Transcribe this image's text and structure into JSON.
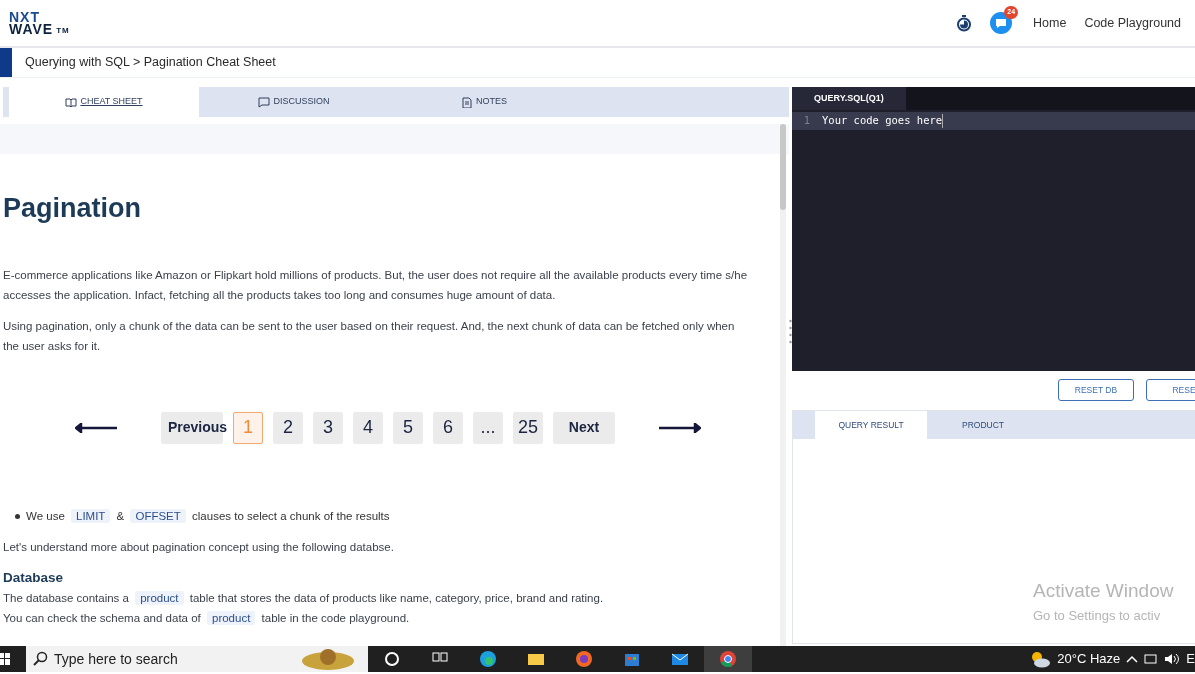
{
  "header": {
    "logo": {
      "line1": "NXT",
      "line2": "WAVE",
      "mark": "TM"
    },
    "notification_count": "24",
    "nav_links": [
      "Home",
      "Code Playground"
    ]
  },
  "breadcrumb": "Querying with SQL > Pagination Cheat Sheet",
  "left_tabs": [
    {
      "label": "CHEAT SHEET",
      "kind": "book",
      "selected": true
    },
    {
      "label": "DISCUSSION",
      "kind": "chat",
      "selected": false
    },
    {
      "label": "NOTES",
      "kind": "notes",
      "selected": false
    }
  ],
  "article": {
    "title": "Pagination",
    "paragraphs": [
      "E-commerce applications like Amazon or Flipkart hold millions of products. But, the user does not require all the available products every time s/he accesses the application. Infact, fetching all the products takes too long and consumes huge amount of data.",
      "Using pagination, only a chunk of the data can be sent to the user based on their request. And, the next chunk of data can be fetched only when the user asks for it."
    ],
    "pager": {
      "previous": "Previous",
      "next": "Next",
      "pages": [
        {
          "label": "1",
          "selected": true
        },
        {
          "label": "2",
          "selected": false
        },
        {
          "label": "3",
          "selected": false
        },
        {
          "label": "4",
          "selected": false
        },
        {
          "label": "5",
          "selected": false
        },
        {
          "label": "6",
          "selected": false
        },
        {
          "label": "...",
          "selected": false
        },
        {
          "label": "25",
          "selected": false
        }
      ]
    },
    "bullet": [
      {
        "kind": "text",
        "text": "We use"
      },
      {
        "kind": "code",
        "text": "LIMIT"
      },
      {
        "kind": "text",
        "text": "&"
      },
      {
        "kind": "code",
        "text": "OFFSET"
      },
      {
        "kind": "text",
        "text": "clauses to select a chunk of the results"
      }
    ],
    "intro": "Let's understand more about pagination concept using the following databse.",
    "section_title": "Database",
    "lines": [
      [
        {
          "kind": "text",
          "text": "The database contains a"
        },
        {
          "kind": "code",
          "text": "product"
        },
        {
          "kind": "text",
          "text": "table that stores the data of products like name, category, price, brand and rating."
        }
      ],
      [
        {
          "kind": "text",
          "text": "You can check the schema and data of"
        },
        {
          "kind": "code",
          "text": "product"
        },
        {
          "kind": "text",
          "text": "table in the code playground."
        }
      ]
    ]
  },
  "editor": {
    "tab": "QUERY.SQL(Q1)",
    "lines": [
      {
        "number": "1",
        "code": "Your code goes here"
      }
    ]
  },
  "editor_buttons": [
    "RESET DB",
    "RESE"
  ],
  "result_tabs": [
    {
      "label": "QUERY RESULT",
      "selected": true
    },
    {
      "label": "PRODUCT",
      "selected": false
    }
  ],
  "activation_notice": {
    "title": "Activate Window",
    "subtitle": "Go to Settings to activ"
  },
  "taskbar": {
    "search_placeholder": "Type here to search",
    "weather": "20°C  Haze",
    "tray_cut": "E"
  }
}
